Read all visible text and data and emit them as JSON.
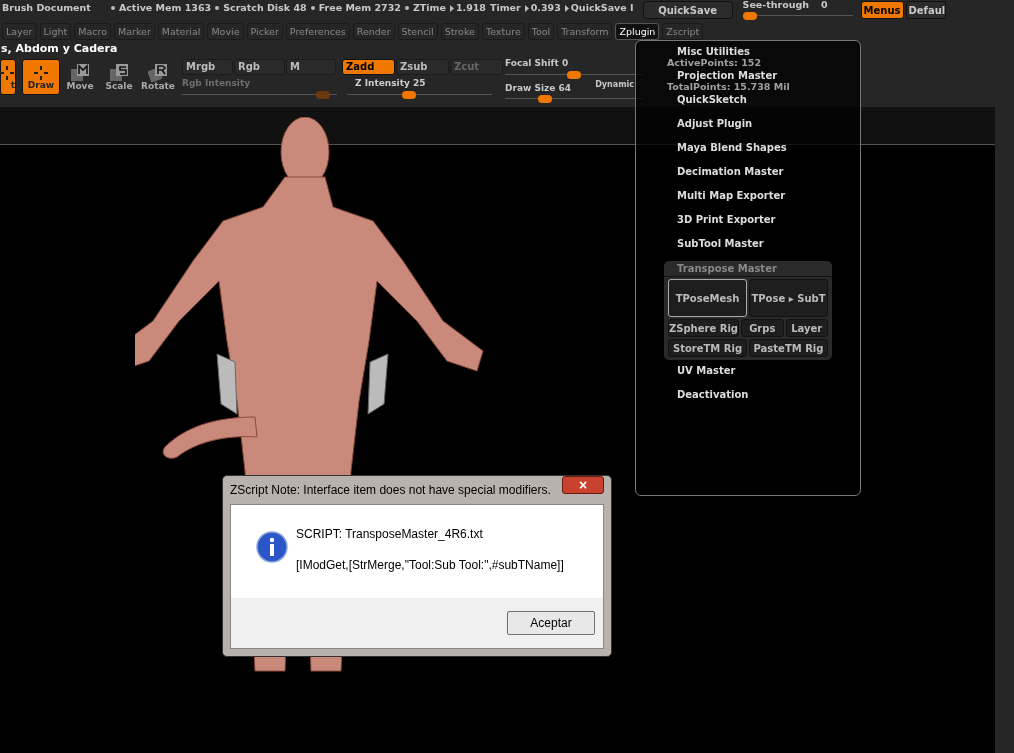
{
  "header": {
    "title": "Brush Document",
    "stats": [
      {
        "text": "Active Mem 1363",
        "kind": "dot"
      },
      {
        "text": "Scratch Disk 48",
        "kind": "dot"
      },
      {
        "text": "Free Mem 2732",
        "kind": "dot"
      },
      {
        "text": "ZTime",
        "kind": "dot"
      },
      {
        "text": "1.918",
        "kind": "arrow"
      },
      {
        "text": "Timer",
        "kind": "plain"
      },
      {
        "text": "0.393",
        "kind": "arrow"
      },
      {
        "text": "QuickSave I",
        "kind": "arrow"
      }
    ],
    "quicksave": "QuickSave",
    "see_through": {
      "label": "See-through",
      "value": "0",
      "level": 0.0
    },
    "menus": {
      "label": "Menus",
      "selected": true
    },
    "default": {
      "label": "Defaul",
      "selected": false
    }
  },
  "tabs": [
    {
      "label": "Layer",
      "selected": false
    },
    {
      "label": "Light",
      "selected": false
    },
    {
      "label": "Macro",
      "selected": false
    },
    {
      "label": "Marker",
      "selected": false
    },
    {
      "label": "Material",
      "selected": false
    },
    {
      "label": "Movie",
      "selected": false
    },
    {
      "label": "Picker",
      "selected": false
    },
    {
      "label": "Preferences",
      "selected": false
    },
    {
      "label": "Render",
      "selected": false
    },
    {
      "label": "Stencil",
      "selected": false
    },
    {
      "label": "Stroke",
      "selected": false
    },
    {
      "label": "Texture",
      "selected": false
    },
    {
      "label": "Tool",
      "selected": false
    },
    {
      "label": "Transform",
      "selected": false
    },
    {
      "label": "Zplugin",
      "selected": true
    },
    {
      "label": "Zscript",
      "selected": false
    }
  ],
  "document_title": "s, Abdom y Cadera",
  "tools": [
    {
      "label": "t",
      "kind": "edit",
      "selected": true
    },
    {
      "label": "Draw",
      "kind": "draw",
      "selected": true
    },
    {
      "label": "Move",
      "kind": "move",
      "selected": false
    },
    {
      "label": "Scale",
      "kind": "scale",
      "selected": false
    },
    {
      "label": "Rotate",
      "kind": "rotate",
      "selected": false
    }
  ],
  "color_modes": [
    {
      "label": "Mrgb",
      "selected": false
    },
    {
      "label": "Rgb",
      "selected": false
    },
    {
      "label": "M",
      "selected": false
    }
  ],
  "z_modes": [
    {
      "label": "Zadd",
      "selected": true,
      "disabled": false
    },
    {
      "label": "Zsub",
      "selected": false,
      "disabled": false
    },
    {
      "label": "Zcut",
      "selected": false,
      "disabled": true
    }
  ],
  "rgb_intensity": {
    "label": "Rgb Intensity",
    "disabled": true,
    "level": 0.95
  },
  "z_intensity": {
    "label": "Z Intensity",
    "value": "25",
    "disabled": false,
    "level": 0.42
  },
  "focal_shift": {
    "label": "Focal Shift",
    "value": "0",
    "level": 0.5
  },
  "draw_size": {
    "label": "Draw Size",
    "value": "64",
    "level": 0.27
  },
  "dynamic": "Dynamic",
  "points": [
    "ActivePoints: 152",
    "TotalPoints: 15.738 Mil"
  ],
  "zplugin_menu": {
    "items": [
      {
        "label": "Misc Utilities",
        "kind": "item"
      },
      {
        "label": "Projection Master",
        "kind": "item"
      },
      {
        "label": "QuickSketch",
        "kind": "item"
      },
      {
        "label": "Adjust Plugin",
        "kind": "item"
      },
      {
        "label": "Maya Blend Shapes",
        "kind": "item"
      },
      {
        "label": "Decimation Master",
        "kind": "item"
      },
      {
        "label": "Multi Map Exporter",
        "kind": "item"
      },
      {
        "label": "3D Print Exporter",
        "kind": "item"
      },
      {
        "label": "SubTool Master",
        "kind": "item"
      },
      {
        "label": "Transpose Master",
        "kind": "group",
        "expanded": true,
        "rows": [
          [
            {
              "label": "TPoseMesh",
              "highlighted": true
            },
            {
              "label": "TPose ▸ SubT",
              "highlighted": false
            }
          ],
          [
            {
              "label": "ZSphere Rig",
              "highlighted": false
            },
            {
              "label": "Grps",
              "highlighted": false
            },
            {
              "label": "Layer",
              "highlighted": false
            }
          ],
          [
            {
              "label": "StoreTM Rig",
              "highlighted": false
            },
            {
              "label": "PasteTM Rig",
              "highlighted": false
            }
          ]
        ]
      },
      {
        "label": "UV Master",
        "kind": "item"
      },
      {
        "label": "Deactivation",
        "kind": "item"
      }
    ]
  },
  "dialog": {
    "title": "ZScript Note: Interface item does not have special modifiers.",
    "close": "×",
    "lines": [
      "SCRIPT: TransposeMaster_4R6.txt",
      "[IModGet,[StrMerge,\"Tool:Sub Tool:\",#subTName]]"
    ],
    "button": "Aceptar"
  }
}
